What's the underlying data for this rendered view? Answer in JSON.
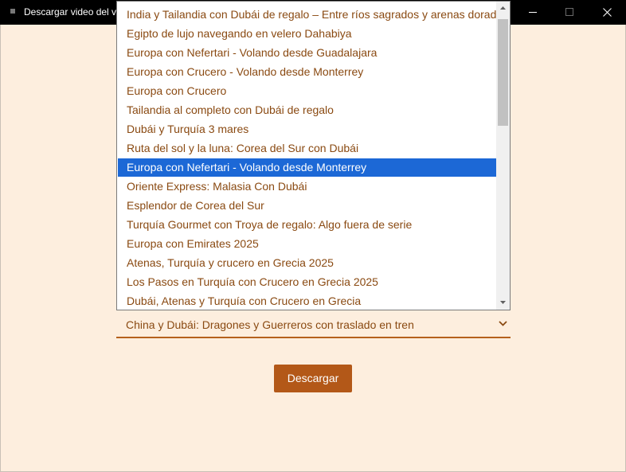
{
  "window": {
    "title": "Descargar video del vi",
    "minimize_icon": "minimize-icon",
    "maximize_icon": "maximize-icon",
    "close_icon": "close-icon"
  },
  "form": {
    "select": {
      "selected_value": "China y Dubái: Dragones y Guerreros con traslado en tren",
      "chevron_icon": "chevron-down-icon"
    },
    "download_label": "Descargar"
  },
  "dropdown": {
    "highlighted_index": 8,
    "options": [
      "India y Tailandia con Dubái de regalo – Entre ríos sagrados y arenas doradas",
      "Egipto de lujo navegando en velero Dahabiya",
      "Europa con Nefertari - Volando desde Guadalajara",
      "Europa con Crucero - Volando desde Monterrey",
      "Europa con Crucero",
      "Tailandia al completo con Dubái de regalo",
      "Dubái y Turquía 3 mares",
      "Ruta del sol y la luna: Corea del Sur con Dubái",
      "Europa con Nefertari - Volando desde Monterrey",
      "Oriente Express: Malasia Con Dubái",
      "Esplendor de Corea del Sur",
      "Turquía Gourmet con Troya de regalo: Algo fuera de serie",
      "Europa con Emirates 2025",
      "Atenas, Turquía y crucero en Grecia 2025",
      "Los Pasos en Turquía con Crucero en Grecia 2025",
      "Dubái, Atenas y Turquía con Crucero en Grecia"
    ]
  },
  "colors": {
    "background": "#fdeede",
    "accent": "#b35818",
    "option_text": "#8a4a12",
    "highlight": "#1c68d6"
  }
}
